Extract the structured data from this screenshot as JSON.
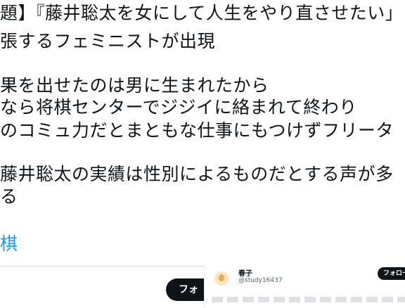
{
  "tweet": {
    "lines": [
      "題】『藤井聡太を女にして人生をやり直させたい」",
      "張するフェミニストが出現",
      "果を出せたのは男に生まれたから",
      "なら将棋センターでジジイに絡まれて終わり",
      "のコミュ力だとまともな仕事にもつけずフリータ",
      "藤井聡太の実績は性別によるものだとする声が多",
      "る"
    ],
    "hashtag_partial": "棋"
  },
  "follow_button_left": {
    "label": "フォ"
  },
  "embedded_tweet": {
    "display_name": "春子",
    "handle": "@study16437",
    "follow_label": "フォロー"
  }
}
